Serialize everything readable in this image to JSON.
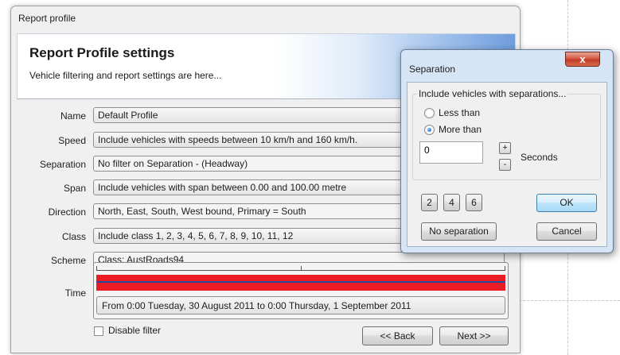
{
  "main_window": {
    "title": "Report profile",
    "header": {
      "title": "Report Profile settings",
      "subtitle": "Vehicle filtering and report settings are here..."
    },
    "rows": [
      {
        "label": "Name",
        "value": "Default Profile"
      },
      {
        "label": "Speed",
        "value": "Include vehicles with speeds between 10 km/h and 160 km/h."
      },
      {
        "label": "Separation",
        "value": "No filter on Separation - (Headway)"
      },
      {
        "label": "Span",
        "value": "Include vehicles with span between 0.00 and 100.00 metre"
      },
      {
        "label": "Direction",
        "value": "North, East, South, West bound, Primary = South"
      },
      {
        "label": "Class",
        "value": "Include class  1, 2, 3, 4, 5, 6, 7, 8, 9, 10, 11, 12"
      },
      {
        "label": "Scheme",
        "value": "Class: AustRoads94"
      }
    ],
    "time": {
      "label": "Time",
      "range_text": "From 0:00 Tuesday, 30 August 2011 to 0:00 Thursday, 1 September 2011",
      "bar_color": "#ec1c24"
    },
    "disable_filter": {
      "label": "Disable filter",
      "checked": false
    },
    "back_button": "<< Back",
    "next_button": "Next >>"
  },
  "separation_dialog": {
    "title": "Separation",
    "close_glyph": "x",
    "group_label": "Include vehicles with separations...",
    "options": [
      {
        "label": "Less than",
        "selected": false
      },
      {
        "label": "More than",
        "selected": true
      }
    ],
    "value": "0",
    "unit": "Seconds",
    "increment": "+",
    "decrement": "-",
    "presets": [
      "2",
      "4",
      "6"
    ],
    "ok_button": "OK",
    "no_separation_button": "No separation",
    "cancel_button": "Cancel"
  },
  "colors": {
    "accent": "#3c7fb1",
    "time_bar": "#ec1c24",
    "time_bar_line": "#24489e",
    "close_button": "#c23a23"
  }
}
